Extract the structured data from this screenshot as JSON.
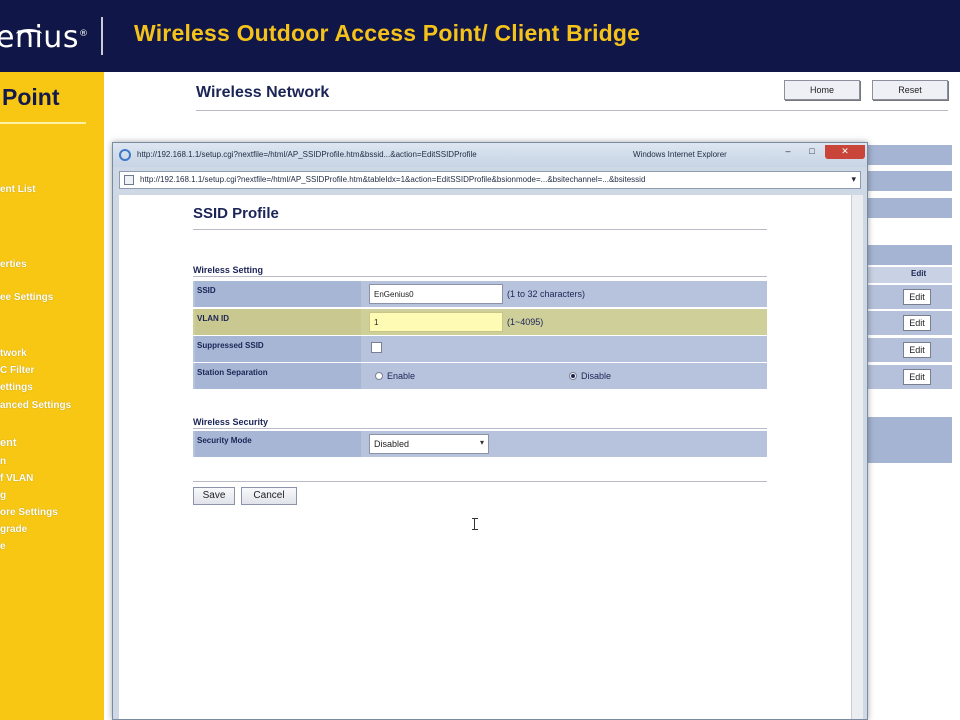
{
  "header": {
    "logo_text": "enius",
    "logo_mark": "®",
    "title": "Wireless Outdoor Access Point/ Client Bridge"
  },
  "sidebar": {
    "title": "Point",
    "items": [
      "ent List",
      "erties",
      "ee Settings",
      "twork",
      "C Filter",
      "ettings",
      "anced Settings",
      "ent",
      "n",
      "f VLAN",
      "g",
      "ore Settings",
      "grade",
      "e"
    ]
  },
  "main": {
    "title": "Wireless Network",
    "home_label": "Home",
    "reset_label": "Reset",
    "table_header": "Edit",
    "edit_label": "Edit"
  },
  "popup": {
    "title_url": "http://192.168.1.1/setup.cgi?nextfile=/html/AP_SSIDProfile.htm&bssid...&action=EditSSIDProfile",
    "title_app": "Windows Internet Explorer",
    "address_url": "http://192.168.1.1/setup.cgi?nextfile=/html/AP_SSIDProfile.htm&tableIdx=1&action=EditSSIDProfile&bsionmode=...&bsitechannel=...&bsitessid",
    "form_title": "SSID Profile",
    "wireless_section": "Wireless Setting",
    "ssid_label": "SSID",
    "ssid_value": "EnGenius0",
    "ssid_hint": "(1 to 32 characters)",
    "vlan_label": "VLAN ID",
    "vlan_value": "1",
    "vlan_hint": "(1~4095)",
    "suppressed_label": "Suppressed SSID",
    "separation_label": "Station Separation",
    "enable_label": "Enable",
    "disable_label": "Disable",
    "security_section": "Wireless Security",
    "security_mode_label": "Security Mode",
    "security_mode_value": "Disabled",
    "save_label": "Save",
    "cancel_label": "Cancel"
  }
}
